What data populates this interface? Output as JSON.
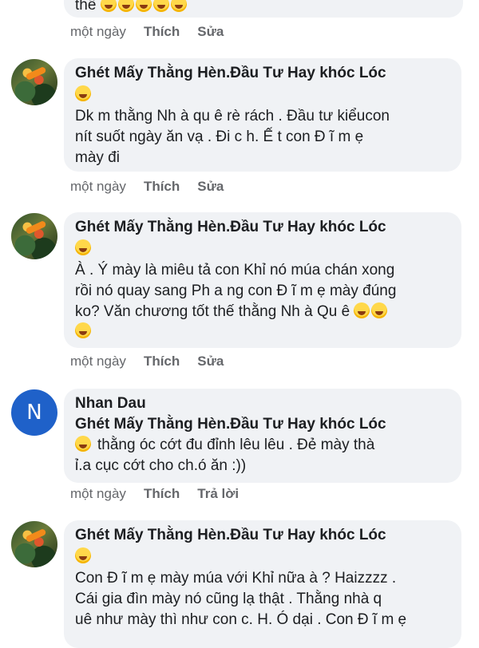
{
  "top_partial": {
    "text_tail": "thế",
    "emojis": 5,
    "time": "một ngày",
    "like": "Thích",
    "edit": "Sửa"
  },
  "comments": [
    {
      "author": "Ghét Mấy Thằng Hèn.Đầu Tư Hay khóc Lóc",
      "lines": [
        "Dk m thằng Nh à qu ê rè rách . Đầu tư kiểucon",
        "nít suốt ngày ăn vạ . Đi c  h. Ế  t con Đ ĩ m ẹ",
        "mày đi"
      ],
      "time": "một ngày",
      "like": "Thích",
      "action": "Sửa"
    },
    {
      "author": "Ghét Mấy Thằng Hèn.Đầu Tư Hay khóc Lóc",
      "lines": [
        "À . Ý mày là miêu tả con Khỉ nó múa chán xong",
        "rồi nó quay sang Ph a ng con Đ ĩ m ẹ mày đúng",
        "ko? Văn chương tốt thế thằng Nh à Qu ê"
      ],
      "time": "một ngày",
      "like": "Thích",
      "action": "Sửa"
    },
    {
      "author": "Nhan Dau",
      "avatar_letter": "N",
      "tag": "Ghét Mấy Thằng Hèn.Đầu Tư Hay khóc Lóc",
      "lines": [
        "thằng óc cớt đu đỉnh lêu lêu . Đẻ mày thà",
        "ỉ.a cục cớt cho ch.ó ăn :))"
      ],
      "time": "một ngày",
      "like": "Thích",
      "action": "Trả lời"
    },
    {
      "author": "Ghét Mấy Thằng Hèn.Đầu Tư Hay khóc Lóc",
      "lines": [
        "Con Đ ĩ m ẹ mày múa với Khỉ nữa à ? Haizzzz .",
        "Cái gia đìn mày nó cũng lạ thật . Thằng nhà q",
        "uê như mày thì như con c. H. Ó dại . Con Đ ĩ m ẹ"
      ]
    }
  ]
}
